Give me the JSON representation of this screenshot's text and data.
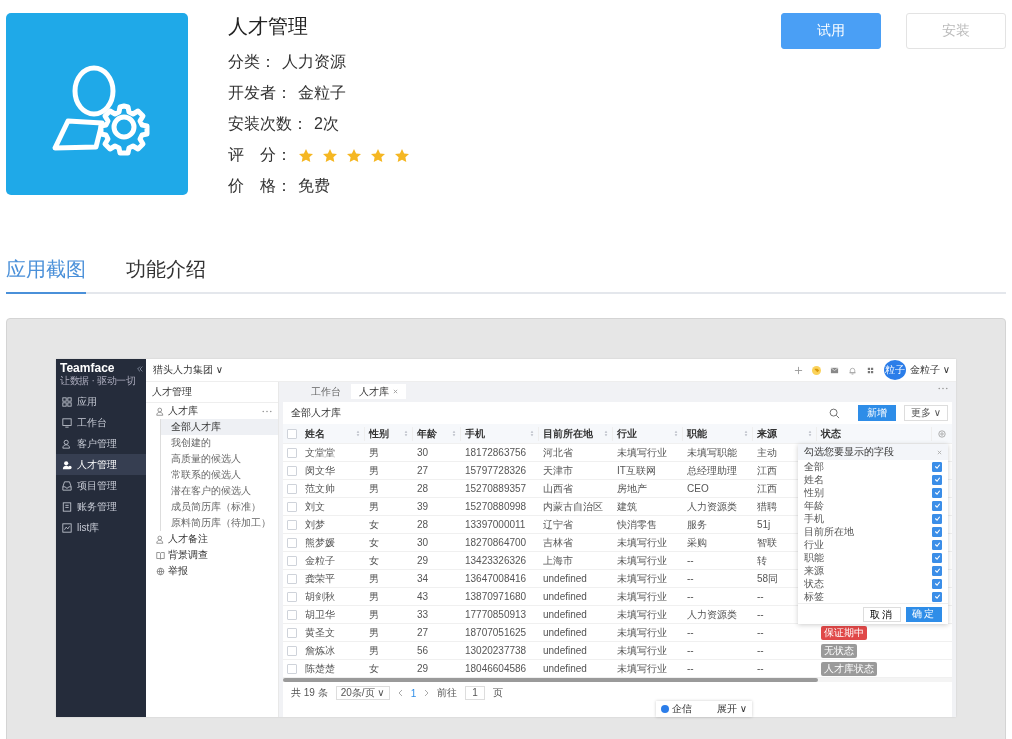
{
  "app": {
    "title": "人才管理",
    "fields": [
      {
        "kind": "text",
        "label": "分类：",
        "value": "人力资源"
      },
      {
        "kind": "text",
        "label": "开发者：",
        "value": "金粒子"
      },
      {
        "kind": "text",
        "label": "安装次数：",
        "value": "2次"
      },
      {
        "kind": "stars",
        "label": "评　分："
      },
      {
        "kind": "text",
        "label": "价　格：",
        "value": "免费"
      }
    ],
    "stars": 5,
    "buttons": [
      {
        "label": "试用",
        "disabled": false
      },
      {
        "label": "安装",
        "disabled": true
      }
    ]
  },
  "tabs": [
    {
      "label": "应用截图",
      "selected": true
    },
    {
      "label": "功能介绍",
      "selected": false
    }
  ],
  "screenshot": {
    "brand": "Teamface",
    "tagline": "让数据 · 驱动一切",
    "nav": [
      {
        "label": "应用",
        "selected": false
      },
      {
        "label": "工作台",
        "selected": false
      },
      {
        "label": "客户管理",
        "selected": false
      },
      {
        "label": "人才管理",
        "selected": true
      },
      {
        "label": "项目管理",
        "selected": false
      },
      {
        "label": "账务管理",
        "selected": false
      },
      {
        "label": "list库",
        "selected": false
      }
    ],
    "org": "猎头人力集团 ∨",
    "avatar": "粒子",
    "user": "金粒子 ∨",
    "tabs": [
      {
        "label": "工作台",
        "selected": false,
        "closable": false
      },
      {
        "label": "人才库",
        "selected": true,
        "closable": true
      }
    ],
    "module_title": "人才管理",
    "tree": [
      {
        "label": "人才库",
        "children": [
          {
            "label": "全部人才库",
            "selected": true
          },
          {
            "label": "我创建的",
            "selected": false
          },
          {
            "label": "高质量的候选人",
            "selected": false
          },
          {
            "label": "常联系的候选人",
            "selected": false
          },
          {
            "label": "潜在客户的候选人",
            "selected": false
          },
          {
            "label": "成员简历库（标准）",
            "selected": false
          },
          {
            "label": "原料简历库（待加工）",
            "selected": false
          }
        ]
      },
      {
        "label": "人才备注"
      },
      {
        "label": "背景调查"
      },
      {
        "label": "举报"
      }
    ],
    "list_title": "全部人才库",
    "add_button": "新增",
    "more_button": "更多 ∨",
    "header_checked": false,
    "columns": [
      {
        "label": "姓名",
        "sortable": true
      },
      {
        "label": "性别",
        "sortable": true
      },
      {
        "label": "年龄",
        "sortable": true
      },
      {
        "label": "手机",
        "sortable": true
      },
      {
        "label": "目前所在地",
        "sortable": true
      },
      {
        "label": "行业",
        "sortable": true
      },
      {
        "label": "职能",
        "sortable": true
      },
      {
        "label": "来源",
        "sortable": true
      },
      {
        "label": "状态",
        "sortable": false
      }
    ],
    "rows": [
      {
        "checked": false,
        "cells": [
          "文堂堂",
          "男",
          "30",
          "18172863756",
          "河北省",
          "未填写行业",
          "未填写职能",
          "主动"
        ]
      },
      {
        "checked": false,
        "cells": [
          "闵文华",
          "男",
          "27",
          "15797728326",
          "天津市",
          "IT互联网",
          "总经理助理",
          "江西"
        ]
      },
      {
        "checked": false,
        "cells": [
          "范文帅",
          "男",
          "28",
          "15270889357",
          "山西省",
          "房地产",
          "CEO",
          "江西"
        ]
      },
      {
        "checked": false,
        "cells": [
          "刘文",
          "男",
          "39",
          "15270880998",
          "内蒙古自治区",
          "建筑",
          "人力资源类",
          "猎聘"
        ]
      },
      {
        "checked": false,
        "cells": [
          "刘梦",
          "女",
          "28",
          "13397000011",
          "辽宁省",
          "快消零售",
          "服务",
          "51j"
        ]
      },
      {
        "checked": false,
        "cells": [
          "熊梦媛",
          "女",
          "30",
          "18270864700",
          "吉林省",
          "未填写行业",
          "采购",
          "智联"
        ]
      },
      {
        "checked": false,
        "cells": [
          "金粒子",
          "女",
          "29",
          "13423326326",
          "上海市",
          "未填写行业",
          "--",
          "转"
        ]
      },
      {
        "checked": false,
        "cells": [
          "龚荣平",
          "男",
          "34",
          "13647008416",
          "undefined",
          "未填写行业",
          "--",
          "58同"
        ]
      },
      {
        "checked": false,
        "cells": [
          "胡剑秋",
          "男",
          "43",
          "13870971680",
          "undefined",
          "未填写行业",
          "--",
          "--"
        ]
      },
      {
        "checked": false,
        "cells": [
          "胡卫华",
          "男",
          "33",
          "17770850913",
          "undefined",
          "未填写行业",
          "人力资源类",
          "--"
        ]
      },
      {
        "checked": false,
        "cells": [
          "黄圣文",
          "男",
          "27",
          "18707051625",
          "undefined",
          "未填写行业",
          "--",
          "--"
        ],
        "status": {
          "label": "保证期中",
          "color": "#e04848"
        }
      },
      {
        "checked": false,
        "cells": [
          "詹炼冰",
          "男",
          "56",
          "13020237738",
          "undefined",
          "未填写行业",
          "--",
          "--"
        ],
        "status": {
          "label": "无状态",
          "color": "#9a9a9a"
        }
      },
      {
        "checked": false,
        "cells": [
          "陈楚楚",
          "女",
          "29",
          "18046604586",
          "undefined",
          "未填写行业",
          "--",
          "--"
        ],
        "status": {
          "label": "人才库状态",
          "color": "#9a9a9a"
        }
      }
    ],
    "field_picker": {
      "title": "勾选您要显示的字段",
      "items": [
        {
          "label": "全部",
          "checked": true
        },
        {
          "label": "姓名",
          "checked": true
        },
        {
          "label": "性别",
          "checked": true
        },
        {
          "label": "年龄",
          "checked": true
        },
        {
          "label": "手机",
          "checked": true
        },
        {
          "label": "目前所在地",
          "checked": true
        },
        {
          "label": "行业",
          "checked": true
        },
        {
          "label": "职能",
          "checked": true
        },
        {
          "label": "来源",
          "checked": true
        },
        {
          "label": "状态",
          "checked": true
        },
        {
          "label": "标签",
          "checked": true
        }
      ],
      "cancel": "取消",
      "confirm": "确定"
    },
    "pagination": {
      "total": "共 19 条",
      "page_size": "20条/页 ∨",
      "pages": [
        {
          "label": "1",
          "selected": true
        }
      ],
      "goto_label": "前往",
      "goto_value": "1",
      "page_suffix": "页"
    },
    "chat": {
      "label": "企信",
      "expand": "展开 ∨"
    }
  }
}
